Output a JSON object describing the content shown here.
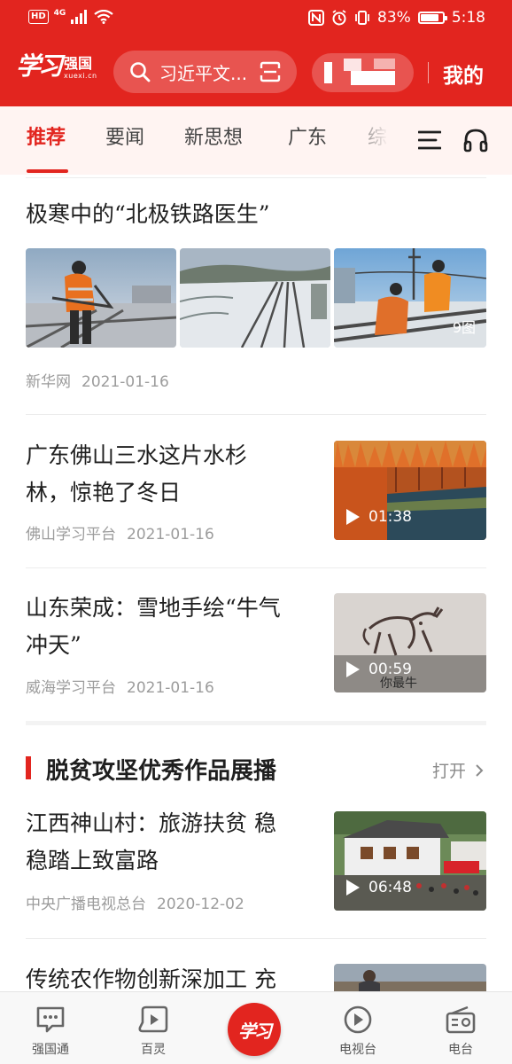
{
  "status_bar": {
    "hd": "HD",
    "network": "4G",
    "battery": "83%",
    "battery_level": 0.83,
    "time": "5:18"
  },
  "header": {
    "logo_script": "学习",
    "logo_name": "强国",
    "logo_domain": "xuexi.cn",
    "search_placeholder": "习近平文...",
    "mine": "我的"
  },
  "tabs": [
    {
      "label": "推荐",
      "active": true
    },
    {
      "label": "要闻",
      "active": false
    },
    {
      "label": "新思想",
      "active": false
    },
    {
      "label": "广东",
      "active": false
    },
    {
      "label": "综合",
      "active": false
    }
  ],
  "feed": {
    "article1": {
      "title": "极寒中的“北极铁路医生”",
      "source": "新华网",
      "date": "2021-01-16",
      "image_count": "9图"
    },
    "article2": {
      "title_line1": "广东佛山三水这片水杉",
      "title_line2": "林，惊艳了冬日",
      "source": "佛山学习平台",
      "date": "2021-01-16",
      "duration": "01:38"
    },
    "article3": {
      "title_line1": "山东荣成：雪地手绘“牛气",
      "title_line2": "冲天”",
      "source": "威海学习平台",
      "date": "2021-01-16",
      "duration": "00:59",
      "snow_text": "你最牛"
    },
    "section": {
      "title": "脱贫攻坚优秀作品展播",
      "open": "打开"
    },
    "article4": {
      "title_line1": "江西神山村：旅游扶贫 稳",
      "title_line2": "稳踏上致富路",
      "source": "中央广播电视总台",
      "date": "2020-12-02",
      "duration": "06:48"
    },
    "article5": {
      "title_line1": "传统农作物创新深加工 充"
    }
  },
  "bottom_nav": [
    {
      "label": "强国通",
      "icon": "chat-icon"
    },
    {
      "label": "百灵",
      "icon": "play-bubble-icon"
    },
    {
      "label": "",
      "icon": "xuexi-logo",
      "logo_text": "学习"
    },
    {
      "label": "电视台",
      "icon": "tv-play-icon"
    },
    {
      "label": "电台",
      "icon": "radio-icon"
    }
  ],
  "colors": {
    "brand_red": "#e2251f",
    "tab_bg": "#fff4f2",
    "meta_gray": "#9c9c9c"
  }
}
